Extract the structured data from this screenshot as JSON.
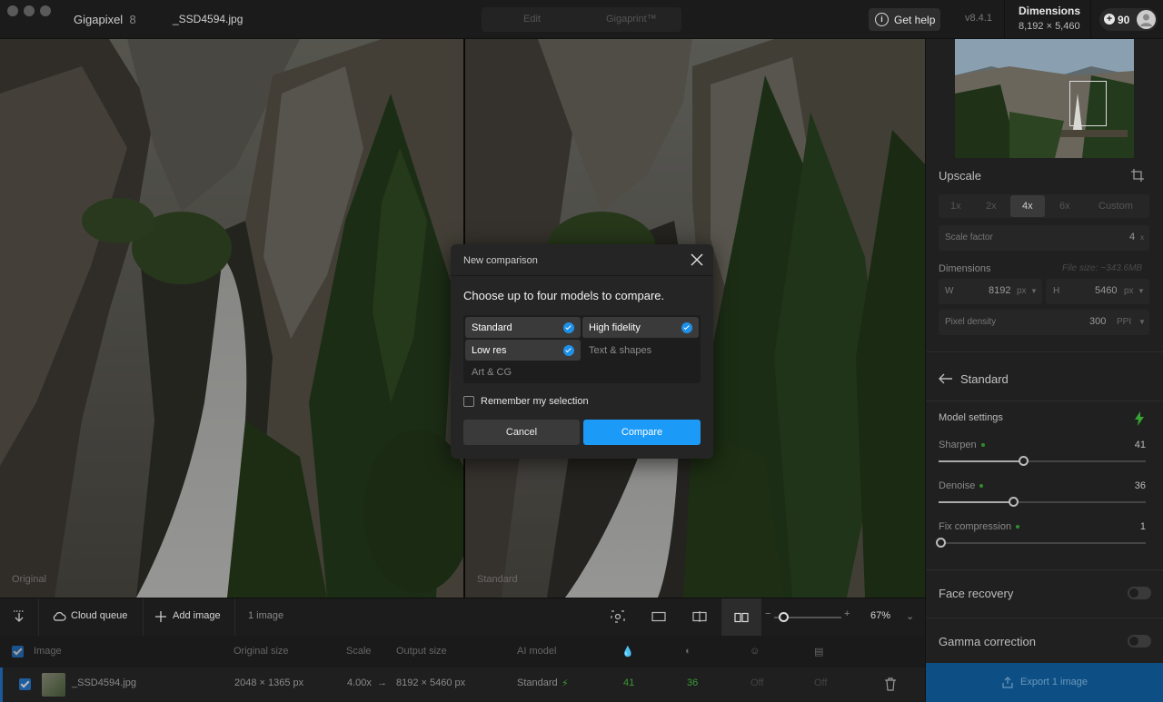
{
  "app": {
    "name": "Gigapixel",
    "version_badge": "8",
    "file": "_SSD4594.jpg",
    "version": "v8.4.1"
  },
  "header": {
    "mode_tabs": [
      "Edit",
      "Gigaprint™"
    ],
    "help_label": "Get help",
    "dimensions_label": "Dimensions",
    "dimensions_value": "8,192 × 5,460",
    "credits": "90"
  },
  "panes": {
    "left_label": "Original",
    "right_label": "Standard"
  },
  "toolbar": {
    "cloud_queue": "Cloud queue",
    "add_image": "Add image",
    "image_count": "1 image",
    "zoom": "67%"
  },
  "table": {
    "headers": {
      "image": "Image",
      "original_size": "Original size",
      "scale": "Scale",
      "output_size": "Output size",
      "ai_model": "AI model"
    },
    "row": {
      "name": "_SSD4594.jpg",
      "original_size": "2048 × 1365 px",
      "scale": "4.00x",
      "output_size": "8192 × 5460 px",
      "model": "Standard",
      "sharpen": "41",
      "denoise": "36",
      "col_off_1": "Off",
      "col_off_2": "Off"
    }
  },
  "sidebar": {
    "upscale_title": "Upscale",
    "scale_options": [
      "1x",
      "2x",
      "4x",
      "6x",
      "Custom"
    ],
    "scale_selected": "4x",
    "scale_factor_label": "Scale factor",
    "scale_factor_value": "4",
    "scale_factor_unit": "x",
    "dimensions_title": "Dimensions",
    "file_size": "File size: ~343.6MB",
    "width_label": "W",
    "width_value": "8192",
    "width_unit": "px",
    "height_label": "H",
    "height_value": "5460",
    "height_unit": "px",
    "pixel_density_label": "Pixel density",
    "pixel_density_value": "300",
    "pixel_density_unit": "PPI",
    "model_name": "Standard",
    "model_settings_title": "Model settings",
    "sliders": [
      {
        "label": "Sharpen",
        "value": "41",
        "level": 0.41
      },
      {
        "label": "Denoise",
        "value": "36",
        "level": 0.36
      },
      {
        "label": "Fix compression",
        "value": "1",
        "level": 0.01
      }
    ],
    "face_recovery": "Face recovery",
    "gamma_correction": "Gamma correction",
    "export_label": "Export 1 image"
  },
  "modal": {
    "title": "New comparison",
    "subtitle": "Choose up to four models to compare.",
    "models": [
      {
        "label": "Standard",
        "selected": true
      },
      {
        "label": "High fidelity",
        "selected": true
      },
      {
        "label": "Low res",
        "selected": true
      },
      {
        "label": "Text & shapes",
        "selected": false
      },
      {
        "label": "Art & CG",
        "selected": false
      }
    ],
    "remember_label": "Remember my selection",
    "cancel_label": "Cancel",
    "compare_label": "Compare"
  },
  "colors": {
    "accent": "#1b9af7",
    "check_blue": "#1e7ad6",
    "model_green": "#3a9a35",
    "export_blue": "#0d4f84"
  }
}
